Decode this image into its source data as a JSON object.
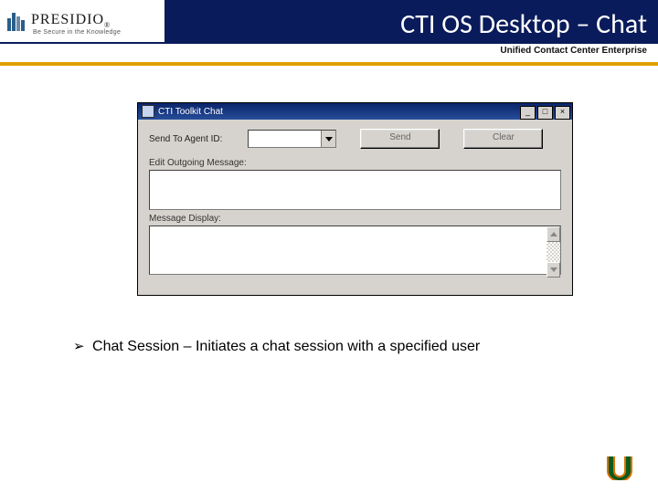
{
  "header": {
    "brand": "PRESIDIO",
    "brand_glyph": "®",
    "brand_tag": "Be Secure in the Knowledge",
    "title": "CTI OS Desktop – Chat",
    "subtitle": "Unified Contact Center Enterprise"
  },
  "dialog": {
    "title": "CTI Toolkit Chat",
    "send_to_label": "Send To Agent ID:",
    "agent_id_value": "",
    "send_btn": "Send",
    "clear_btn": "Clear",
    "outgoing_label": "Edit Outgoing Message:",
    "display_label": "Message Display:",
    "min_glyph": "_",
    "max_glyph": "□",
    "close_glyph": "×"
  },
  "body": {
    "bullet_arrow": "➢",
    "bullet_text": "Chat Session – Initiates a chat session with a specified user"
  }
}
